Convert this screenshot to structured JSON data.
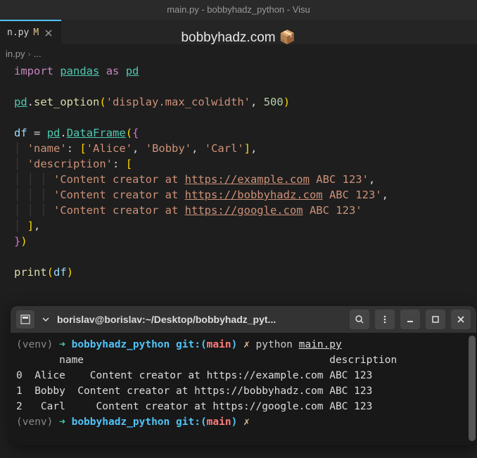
{
  "window": {
    "title": "main.py - bobbyhadz_python - Visu"
  },
  "tab": {
    "name": "n.py",
    "modified_indicator": "M"
  },
  "banner": "bobbyhadz.com 📦",
  "breadcrumb": {
    "file": "in.py",
    "sep": "›",
    "rest": "..."
  },
  "code": {
    "l1_import": "import",
    "l1_pandas": "pandas",
    "l1_as": "as",
    "l1_pd": "pd",
    "l3_pd": "pd",
    "l3_seto": "set_option",
    "l3_arg1": "'display.max_colwidth'",
    "l3_arg2": "500",
    "l5_df": "df",
    "l5_pd": "pd",
    "l5_DF": "DataFrame",
    "l6_name": "'name'",
    "l6_alice": "'Alice'",
    "l6_bobby": "'Bobby'",
    "l6_carl": "'Carl'",
    "l7_desc": "'description'",
    "l8_s1a": "'Content creator at ",
    "l8_url": "https://example.com",
    "l8_s1b": " ABC 123'",
    "l9_s1a": "'Content creator at ",
    "l9_url": "https://bobbyhadz.com",
    "l9_s1b": " ABC 123'",
    "l10_s1a": "'Content creator at ",
    "l10_url": "https://google.com",
    "l10_s1b": " ABC 123'",
    "l13_print": "print",
    "l13_df": "df"
  },
  "terminal": {
    "title": "borislav@borislav:~/Desktop/bobbyhadz_pyt...",
    "venv": "(venv)",
    "arrow": "➜",
    "dir": "bobbyhadz_python",
    "git": "git:",
    "paren_o": "(",
    "branch": "main",
    "paren_c": ")",
    "x": "✗",
    "cmd_python": "python",
    "cmd_file": "main.py",
    "out_header": "       name                                        description",
    "out_r0": "0  Alice    Content creator at https://example.com ABC 123",
    "out_r1": "1  Bobby  Content creator at https://bobbyhadz.com ABC 123",
    "out_r2": "2   Carl     Content creator at https://google.com ABC 123"
  }
}
